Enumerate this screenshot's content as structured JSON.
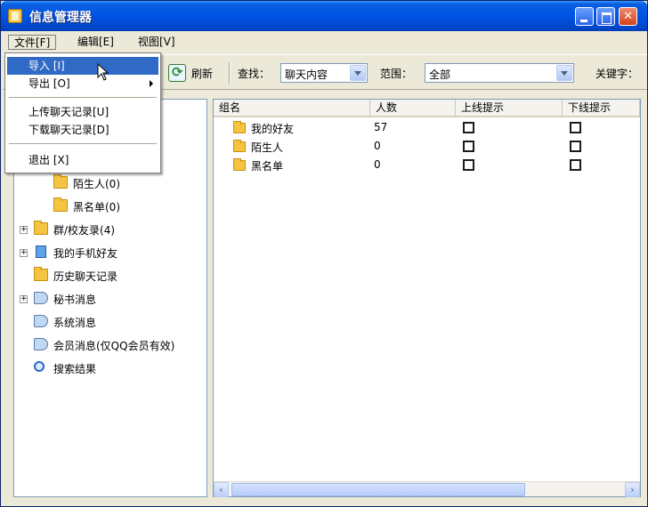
{
  "window": {
    "title": "信息管理器"
  },
  "menubar": [
    {
      "label": "文件[F]"
    },
    {
      "label": "编辑[E]"
    },
    {
      "label": "视图[V]"
    }
  ],
  "file_menu": [
    {
      "label": "导入 [I]",
      "highlighted": true
    },
    {
      "label": "导出 [O]",
      "has_submenu": true
    },
    {
      "label": "上传聊天记录[U]"
    },
    {
      "label": "下载聊天记录[D]"
    },
    {
      "label": "退出 [X]"
    }
  ],
  "toolbar": {
    "refresh_label": "刷新",
    "search_label": "查找：",
    "search_value": "聊天内容",
    "range_label": "范围：",
    "range_value": "全部",
    "keyword_label": "关键字："
  },
  "tree": [
    {
      "label": "陌生人(0)",
      "icon": "folder-icon"
    },
    {
      "label": "黑名单(0)",
      "icon": "folder-icon"
    },
    {
      "label": "群/校友录(4)",
      "icon": "folder-icon"
    },
    {
      "label": "我的手机好友",
      "icon": "phone-icon"
    },
    {
      "label": "历史聊天记录",
      "icon": "folder-icon"
    },
    {
      "label": "秘书消息",
      "icon": "speaker-icon"
    },
    {
      "label": "系统消息",
      "icon": "speaker-icon"
    },
    {
      "label": "会员消息(仅QQ会员有效)",
      "icon": "speaker-icon"
    },
    {
      "label": "搜索结果",
      "icon": "search-icon"
    }
  ],
  "list": {
    "columns": [
      "组名",
      "人数",
      "上线提示",
      "下线提示"
    ],
    "rows": [
      {
        "name": "我的好友",
        "count": "57",
        "online": false,
        "offline": false
      },
      {
        "name": "陌生人",
        "count": "0",
        "online": false,
        "offline": false
      },
      {
        "name": "黑名单",
        "count": "0",
        "online": false,
        "offline": false
      }
    ]
  }
}
